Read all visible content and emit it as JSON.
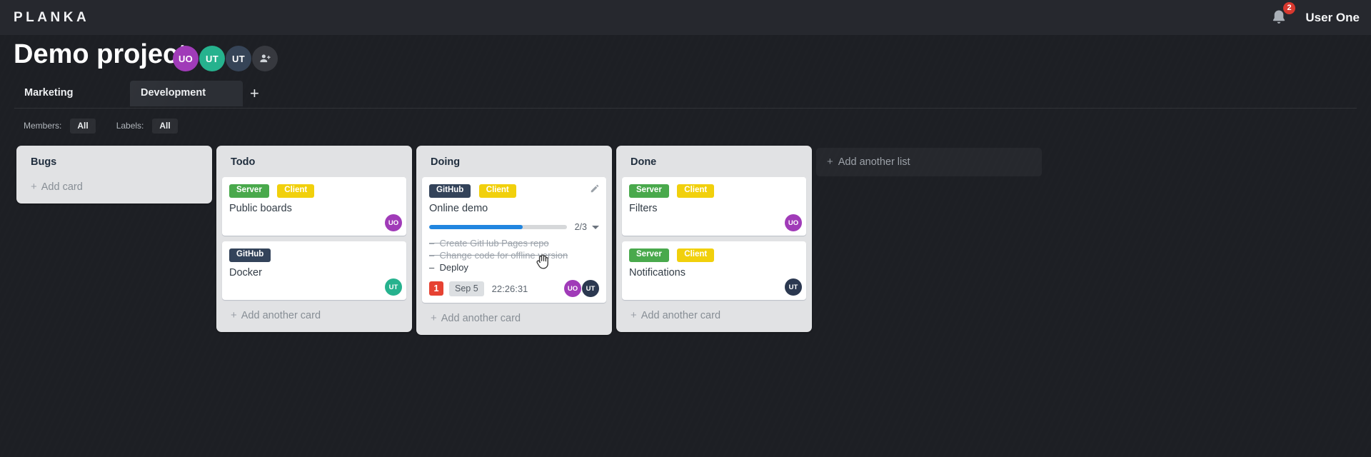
{
  "topbar": {
    "logo": "PLANKA",
    "notification_count": "2",
    "user_name": "User One"
  },
  "project": {
    "title": "Demo project",
    "members": [
      {
        "initials": "UO",
        "color": "#a03bb8"
      },
      {
        "initials": "UT",
        "color": "#26b28e"
      },
      {
        "initials": "UT",
        "color": "#364457"
      }
    ]
  },
  "tabs": {
    "items": [
      {
        "label": "Marketing",
        "active": false
      },
      {
        "label": "Development",
        "active": true
      }
    ],
    "add_label": "+"
  },
  "filters": {
    "members_label": "Members:",
    "members_value": "All",
    "labels_label": "Labels:",
    "labels_value": "All"
  },
  "board": {
    "add_list_label": "Add another list",
    "lists": [
      {
        "title": "Bugs",
        "add_label": "Add card",
        "cards": []
      },
      {
        "title": "Todo",
        "add_label": "Add another card",
        "cards": [
          {
            "title": "Public boards",
            "labels": [
              {
                "text": "Server",
                "color": "#49a94c"
              },
              {
                "text": "Client",
                "color": "#f1d00c"
              }
            ],
            "members": [
              {
                "initials": "UO",
                "color": "#a03bb8"
              }
            ]
          },
          {
            "title": "Docker",
            "labels": [
              {
                "text": "GitHub",
                "color": "#33435a"
              }
            ],
            "members": [
              {
                "initials": "UT",
                "color": "#26b28e"
              }
            ]
          }
        ]
      },
      {
        "title": "Doing",
        "add_label": "Add another card",
        "cards": [
          {
            "title": "Online demo",
            "labels": [
              {
                "text": "GitHub",
                "color": "#33435a"
              },
              {
                "text": "Client",
                "color": "#f1d00c"
              }
            ],
            "progress": {
              "label": "2/3",
              "completed": 2,
              "total": 3,
              "percent": 68,
              "bar_color": "#2186e0"
            },
            "tasks": [
              {
                "text": "Create GitHub Pages repo",
                "completed": true
              },
              {
                "text": "Change code for offline version",
                "completed": true
              },
              {
                "text": "Deploy",
                "completed": false
              }
            ],
            "notification_count": "1",
            "notification_color": "#e64232",
            "due_date": "Sep 5",
            "timer": "22:26:31",
            "members": [
              {
                "initials": "UO",
                "color": "#a03bb8"
              },
              {
                "initials": "UT",
                "color": "#2b3850"
              }
            ]
          }
        ]
      },
      {
        "title": "Done",
        "add_label": "Add another card",
        "cards": [
          {
            "title": "Filters",
            "labels": [
              {
                "text": "Server",
                "color": "#49a94c"
              },
              {
                "text": "Client",
                "color": "#f1d00c"
              }
            ],
            "members": [
              {
                "initials": "UO",
                "color": "#a03bb8"
              }
            ]
          },
          {
            "title": "Notifications",
            "labels": [
              {
                "text": "Server",
                "color": "#49a94c"
              },
              {
                "text": "Client",
                "color": "#f1d00c"
              }
            ],
            "members": [
              {
                "initials": "UT",
                "color": "#2b3850"
              }
            ]
          }
        ]
      }
    ]
  }
}
